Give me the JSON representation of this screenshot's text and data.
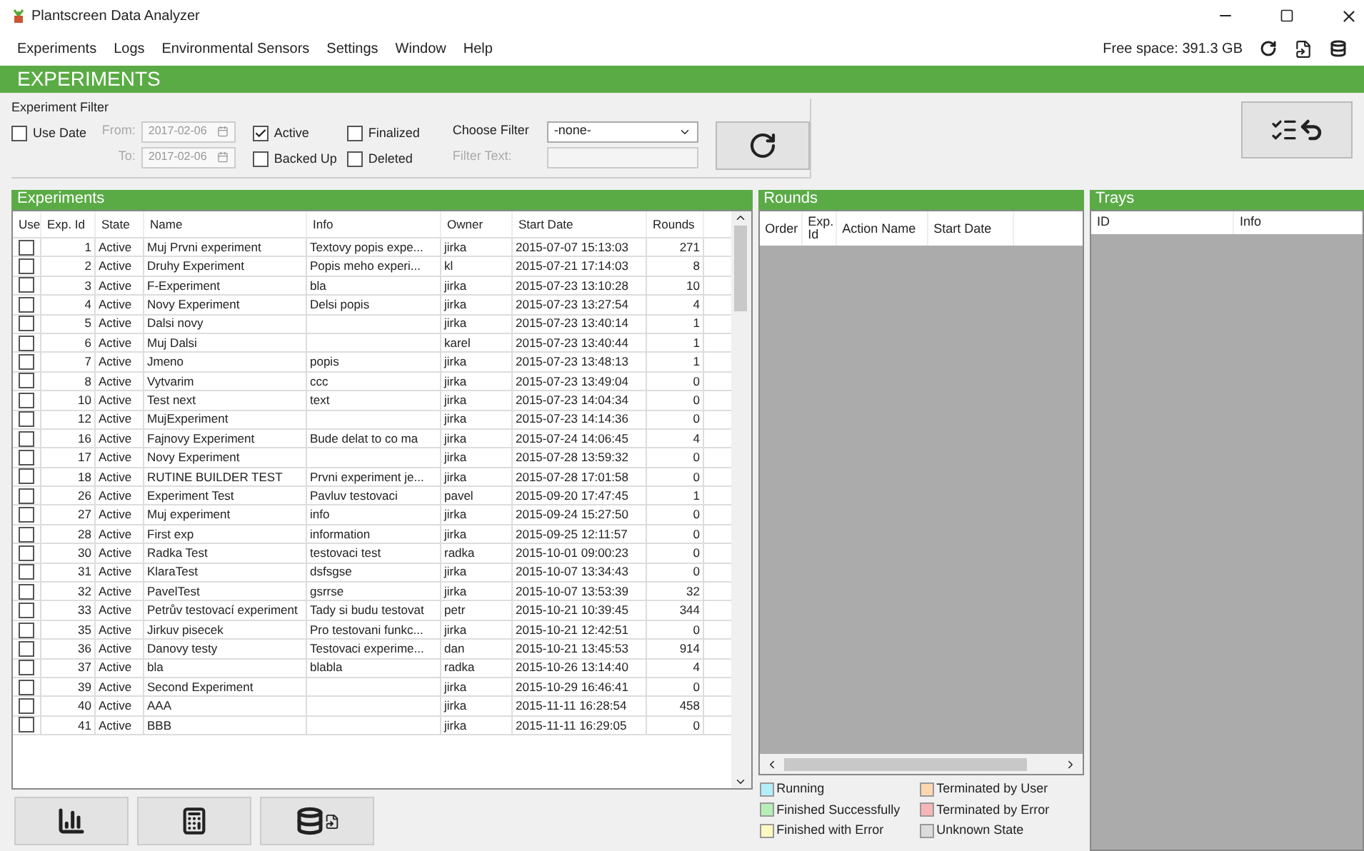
{
  "window": {
    "title": "Plantscreen Data Analyzer"
  },
  "menu": [
    "Experiments",
    "Logs",
    "Environmental Sensors",
    "Settings",
    "Window",
    "Help"
  ],
  "free_space": "Free space: 391.3 GB",
  "section_title": "EXPERIMENTS",
  "filter": {
    "title": "Experiment Filter",
    "use_date": {
      "label": "Use Date",
      "checked": false
    },
    "from_label": "From:",
    "from": "2017-02-06",
    "to_label": "To:",
    "to": "2017-02-06",
    "checks": [
      {
        "label": "Active",
        "checked": true
      },
      {
        "label": "Finalized",
        "checked": false
      },
      {
        "label": "Backed Up",
        "checked": false
      },
      {
        "label": "Deleted",
        "checked": false
      }
    ],
    "choose_label": "Choose Filter",
    "choose_value": "-none-",
    "text_label": "Filter Text:"
  },
  "experiments": {
    "title": "Experiments",
    "columns": [
      "Use",
      "Exp. Id",
      "State",
      "Name",
      "Info",
      "Owner",
      "Start Date",
      "Rounds"
    ],
    "rows": [
      {
        "use": false,
        "id": "1",
        "state": "Active",
        "name": "Muj Prvni experiment",
        "info": "Textovy popis expe...",
        "owner": "jirka",
        "start": "2015-07-07 15:13:03",
        "rounds": "271"
      },
      {
        "use": false,
        "id": "2",
        "state": "Active",
        "name": "Druhy Experiment",
        "info": "Popis meho experi...",
        "owner": "kl",
        "start": "2015-07-21 17:14:03",
        "rounds": "8"
      },
      {
        "use": false,
        "id": "3",
        "state": "Active",
        "name": "F-Experiment",
        "info": "bla",
        "owner": "jirka",
        "start": "2015-07-23 13:10:28",
        "rounds": "10"
      },
      {
        "use": false,
        "id": "4",
        "state": "Active",
        "name": "Novy Experiment",
        "info": "Delsi popis",
        "owner": "jirka",
        "start": "2015-07-23 13:27:54",
        "rounds": "4"
      },
      {
        "use": false,
        "id": "5",
        "state": "Active",
        "name": "Dalsi novy",
        "info": "",
        "owner": "jirka",
        "start": "2015-07-23 13:40:14",
        "rounds": "1"
      },
      {
        "use": false,
        "id": "6",
        "state": "Active",
        "name": "Muj Dalsi",
        "info": "",
        "owner": "karel",
        "start": "2015-07-23 13:40:44",
        "rounds": "1"
      },
      {
        "use": false,
        "id": "7",
        "state": "Active",
        "name": "Jmeno",
        "info": "popis",
        "owner": "jirka",
        "start": "2015-07-23 13:48:13",
        "rounds": "1"
      },
      {
        "use": false,
        "id": "8",
        "state": "Active",
        "name": "Vytvarim",
        "info": "ccc",
        "owner": "jirka",
        "start": "2015-07-23 13:49:04",
        "rounds": "0"
      },
      {
        "use": false,
        "id": "10",
        "state": "Active",
        "name": "Test next",
        "info": "text",
        "owner": "jirka",
        "start": "2015-07-23 14:04:34",
        "rounds": "0"
      },
      {
        "use": false,
        "id": "12",
        "state": "Active",
        "name": "MujExperiment",
        "info": "",
        "owner": "jirka",
        "start": "2015-07-23 14:14:36",
        "rounds": "0"
      },
      {
        "use": false,
        "id": "16",
        "state": "Active",
        "name": "Fajnovy Experiment",
        "info": "Bude delat to co ma",
        "owner": "jirka",
        "start": "2015-07-24 14:06:45",
        "rounds": "4"
      },
      {
        "use": false,
        "id": "17",
        "state": "Active",
        "name": "Novy Experiment",
        "info": "",
        "owner": "jirka",
        "start": "2015-07-28 13:59:32",
        "rounds": "0"
      },
      {
        "use": false,
        "id": "18",
        "state": "Active",
        "name": "RUTINE BUILDER TEST",
        "info": "Prvni experiment je...",
        "owner": "jirka",
        "start": "2015-07-28 17:01:58",
        "rounds": "0"
      },
      {
        "use": false,
        "id": "26",
        "state": "Active",
        "name": "Experiment Test",
        "info": "Pavluv testovaci",
        "owner": "pavel",
        "start": "2015-09-20 17:47:45",
        "rounds": "1"
      },
      {
        "use": false,
        "id": "27",
        "state": "Active",
        "name": "Muj experiment",
        "info": "info",
        "owner": "jirka",
        "start": "2015-09-24 15:27:50",
        "rounds": "0"
      },
      {
        "use": false,
        "id": "28",
        "state": "Active",
        "name": "First exp",
        "info": "information",
        "owner": "jirka",
        "start": "2015-09-25 12:11:57",
        "rounds": "0"
      },
      {
        "use": false,
        "id": "30",
        "state": "Active",
        "name": "Radka Test",
        "info": "testovaci test",
        "owner": "radka",
        "start": "2015-10-01 09:00:23",
        "rounds": "0"
      },
      {
        "use": false,
        "id": "31",
        "state": "Active",
        "name": "KlaraTest",
        "info": "dsfsgse",
        "owner": "jirka",
        "start": "2015-10-07 13:34:43",
        "rounds": "0"
      },
      {
        "use": false,
        "id": "32",
        "state": "Active",
        "name": "PavelTest",
        "info": "gsrrse",
        "owner": "jirka",
        "start": "2015-10-07 13:53:39",
        "rounds": "32"
      },
      {
        "use": false,
        "id": "33",
        "state": "Active",
        "name": "Petrův testovací experiment",
        "info": "Tady si budu testovat",
        "owner": "petr",
        "start": "2015-10-21 10:39:45",
        "rounds": "344"
      },
      {
        "use": false,
        "id": "35",
        "state": "Active",
        "name": "Jirkuv pisecek",
        "info": "Pro testovani funkc...",
        "owner": "jirka",
        "start": "2015-10-21 12:42:51",
        "rounds": "0"
      },
      {
        "use": false,
        "id": "36",
        "state": "Active",
        "name": "Danovy testy",
        "info": "Testovaci experime...",
        "owner": "dan",
        "start": "2015-10-21 13:45:53",
        "rounds": "914"
      },
      {
        "use": false,
        "id": "37",
        "state": "Active",
        "name": "bla",
        "info": "blabla",
        "owner": "radka",
        "start": "2015-10-26 13:14:40",
        "rounds": "4"
      },
      {
        "use": false,
        "id": "39",
        "state": "Active",
        "name": "Second Experiment",
        "info": "",
        "owner": "jirka",
        "start": "2015-10-29 16:46:41",
        "rounds": "0"
      },
      {
        "use": false,
        "id": "40",
        "state": "Active",
        "name": "AAA",
        "info": "",
        "owner": "jirka",
        "start": "2015-11-11 16:28:54",
        "rounds": "458"
      },
      {
        "use": false,
        "id": "41",
        "state": "Active",
        "name": "BBB",
        "info": "",
        "owner": "jirka",
        "start": "2015-11-11 16:29:05",
        "rounds": "0"
      }
    ]
  },
  "rounds": {
    "title": "Rounds",
    "columns": [
      "Order",
      "Exp. Id",
      "Action Name",
      "Start Date"
    ]
  },
  "legend": [
    {
      "label": "Running",
      "color": "#b3eef8"
    },
    {
      "label": "Terminated by User",
      "color": "#fcd6b0"
    },
    {
      "label": "Finished Successfully",
      "color": "#b6efb6"
    },
    {
      "label": "Terminated by Error",
      "color": "#f7b6b6"
    },
    {
      "label": "Finished with Error",
      "color": "#fbf8c0"
    },
    {
      "label": "Unknown State",
      "color": "#dcdcdc"
    }
  ],
  "trays": {
    "title": "Trays",
    "columns": [
      "ID",
      "Info"
    ]
  }
}
